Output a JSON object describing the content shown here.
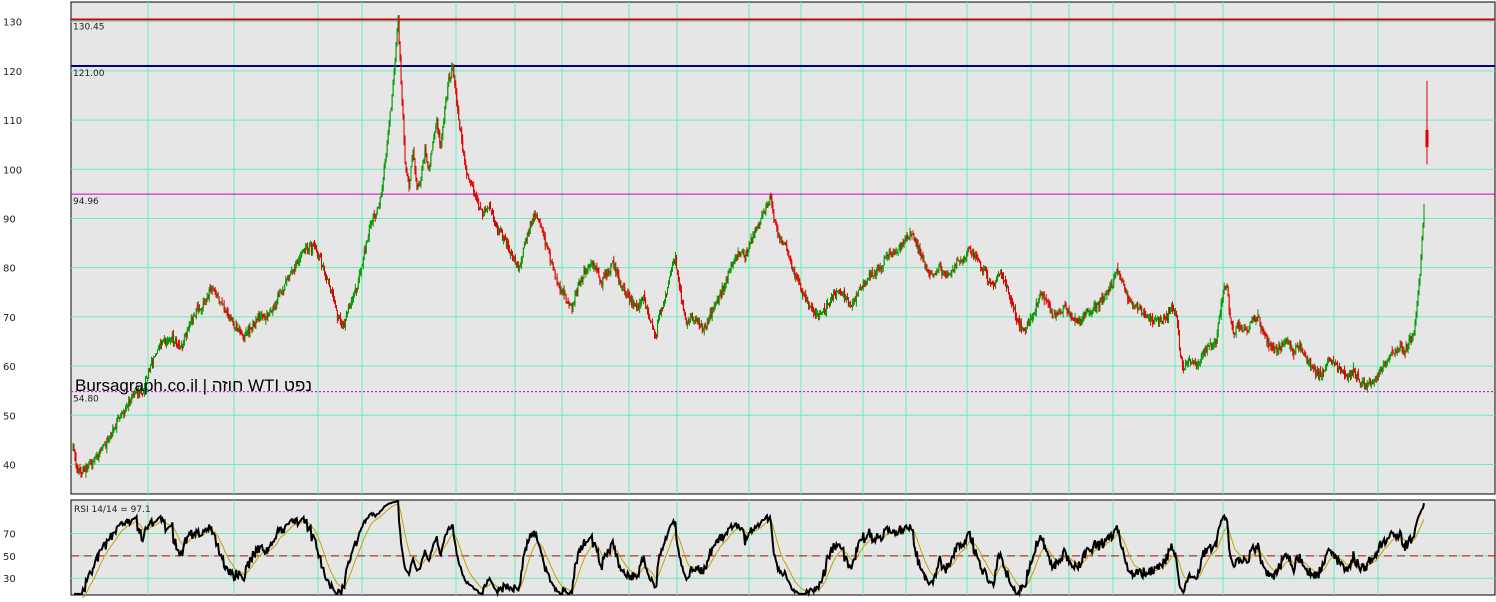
{
  "chart_data": [
    {
      "type": "candlestick",
      "watermark": "Bursagraph.co.il | חוזה WTI נפט",
      "ylim": [
        34,
        134
      ],
      "grid": true,
      "yticks": [
        40,
        50,
        60,
        70,
        80,
        90,
        100,
        110,
        120,
        130
      ],
      "levels": [
        {
          "value": 130.45,
          "label": "130.45",
          "color": "#d00000",
          "style": "solid"
        },
        {
          "value": 121.0,
          "label": "121.00",
          "color": "#000080",
          "style": "solid"
        },
        {
          "value": 94.96,
          "label": "94.96",
          "color": "#d000d0",
          "style": "solid"
        },
        {
          "value": 54.8,
          "label": "54.80",
          "color": "#d000d0",
          "style": "dotted"
        }
      ],
      "price_path": [
        [
          0,
          43.5
        ],
        [
          4,
          39
        ],
        [
          9,
          38.5
        ],
        [
          16,
          40
        ],
        [
          22,
          41
        ],
        [
          30,
          43
        ],
        [
          38,
          46
        ],
        [
          46,
          49
        ],
        [
          54,
          52
        ],
        [
          62,
          54.5
        ],
        [
          70,
          55
        ],
        [
          76,
          59
        ],
        [
          84,
          63
        ],
        [
          92,
          65
        ],
        [
          100,
          66
        ],
        [
          108,
          63
        ],
        [
          116,
          68
        ],
        [
          124,
          71
        ],
        [
          132,
          73
        ],
        [
          140,
          76
        ],
        [
          148,
          73
        ],
        [
          156,
          70
        ],
        [
          164,
          68
        ],
        [
          172,
          66
        ],
        [
          180,
          68
        ],
        [
          188,
          70
        ],
        [
          196,
          70
        ],
        [
          204,
          73
        ],
        [
          212,
          76
        ],
        [
          220,
          79
        ],
        [
          228,
          82
        ],
        [
          236,
          84
        ],
        [
          244,
          84
        ],
        [
          252,
          80
        ],
        [
          260,
          75
        ],
        [
          266,
          70
        ],
        [
          272,
          68
        ],
        [
          278,
          72
        ],
        [
          284,
          75
        ],
        [
          290,
          80
        ],
        [
          296,
          86
        ],
        [
          302,
          90
        ],
        [
          308,
          93
        ],
        [
          312,
          98
        ],
        [
          316,
          105
        ],
        [
          320,
          113
        ],
        [
          324,
          122
        ],
        [
          327,
          130.45
        ],
        [
          330,
          118
        ],
        [
          334,
          102
        ],
        [
          338,
          96
        ],
        [
          342,
          104
        ],
        [
          346,
          96
        ],
        [
          350,
          98
        ],
        [
          354,
          104
        ],
        [
          358,
          100
        ],
        [
          362,
          106
        ],
        [
          366,
          110
        ],
        [
          370,
          104
        ],
        [
          374,
          112
        ],
        [
          378,
          118
        ],
        [
          382,
          121
        ],
        [
          386,
          113
        ],
        [
          390,
          108
        ],
        [
          394,
          101
        ],
        [
          400,
          97
        ],
        [
          406,
          94
        ],
        [
          412,
          91
        ],
        [
          418,
          93
        ],
        [
          424,
          89
        ],
        [
          430,
          87
        ],
        [
          436,
          85
        ],
        [
          442,
          82
        ],
        [
          448,
          80
        ],
        [
          454,
          84
        ],
        [
          460,
          89
        ],
        [
          466,
          91
        ],
        [
          472,
          87
        ],
        [
          478,
          83
        ],
        [
          484,
          79
        ],
        [
          490,
          76
        ],
        [
          496,
          74
        ],
        [
          502,
          72
        ],
        [
          508,
          76
        ],
        [
          514,
          79
        ],
        [
          520,
          81
        ],
        [
          526,
          80
        ],
        [
          532,
          77
        ],
        [
          538,
          79
        ],
        [
          544,
          81
        ],
        [
          550,
          77
        ],
        [
          556,
          75
        ],
        [
          562,
          73
        ],
        [
          568,
          72
        ],
        [
          574,
          74
        ],
        [
          580,
          70
        ],
        [
          586,
          66
        ],
        [
          590,
          70
        ],
        [
          594,
          73
        ],
        [
          598,
          75
        ],
        [
          602,
          80
        ],
        [
          606,
          82
        ],
        [
          610,
          76
        ],
        [
          614,
          72
        ],
        [
          618,
          68
        ],
        [
          622,
          70
        ],
        [
          626,
          70
        ],
        [
          630,
          69
        ],
        [
          634,
          67
        ],
        [
          640,
          70
        ],
        [
          646,
          72
        ],
        [
          652,
          75
        ],
        [
          658,
          78
        ],
        [
          664,
          81
        ],
        [
          670,
          83
        ],
        [
          676,
          82
        ],
        [
          682,
          86
        ],
        [
          688,
          88
        ],
        [
          694,
          91
        ],
        [
          698,
          93
        ],
        [
          702,
          94
        ],
        [
          706,
          89
        ],
        [
          710,
          86
        ],
        [
          716,
          85
        ],
        [
          722,
          81
        ],
        [
          728,
          78
        ],
        [
          734,
          75
        ],
        [
          740,
          72
        ],
        [
          746,
          71
        ],
        [
          752,
          70
        ],
        [
          758,
          72
        ],
        [
          764,
          74
        ],
        [
          770,
          76
        ],
        [
          776,
          74
        ],
        [
          782,
          72
        ],
        [
          788,
          74
        ],
        [
          794,
          76
        ],
        [
          800,
          78
        ],
        [
          806,
          79
        ],
        [
          812,
          80
        ],
        [
          818,
          82
        ],
        [
          824,
          83
        ],
        [
          830,
          84
        ],
        [
          836,
          86
        ],
        [
          842,
          87
        ],
        [
          848,
          85
        ],
        [
          854,
          82
        ],
        [
          860,
          79
        ],
        [
          866,
          78
        ],
        [
          872,
          80
        ],
        [
          878,
          78
        ],
        [
          884,
          79
        ],
        [
          890,
          81
        ],
        [
          896,
          82
        ],
        [
          902,
          84
        ],
        [
          908,
          82
        ],
        [
          914,
          80
        ],
        [
          920,
          78
        ],
        [
          926,
          76
        ],
        [
          932,
          79
        ],
        [
          938,
          77
        ],
        [
          944,
          73
        ],
        [
          950,
          69
        ],
        [
          956,
          67
        ],
        [
          962,
          69
        ],
        [
          968,
          72
        ],
        [
          974,
          75
        ],
        [
          980,
          73
        ],
        [
          986,
          70
        ],
        [
          992,
          71
        ],
        [
          998,
          72
        ],
        [
          1004,
          70
        ],
        [
          1010,
          69
        ],
        [
          1016,
          70
        ],
        [
          1022,
          71
        ],
        [
          1028,
          72
        ],
        [
          1034,
          73
        ],
        [
          1040,
          75
        ],
        [
          1046,
          77
        ],
        [
          1050,
          80
        ],
        [
          1054,
          78
        ],
        [
          1058,
          75
        ],
        [
          1064,
          73
        ],
        [
          1070,
          72
        ],
        [
          1076,
          71
        ],
        [
          1082,
          70
        ],
        [
          1088,
          69
        ],
        [
          1094,
          69
        ],
        [
          1100,
          70
        ],
        [
          1106,
          72
        ],
        [
          1110,
          70
        ],
        [
          1114,
          62
        ],
        [
          1118,
          59
        ],
        [
          1122,
          62
        ],
        [
          1126,
          60
        ],
        [
          1132,
          61
        ],
        [
          1138,
          63
        ],
        [
          1144,
          64
        ],
        [
          1150,
          65
        ],
        [
          1156,
          74
        ],
        [
          1160,
          77
        ],
        [
          1164,
          70
        ],
        [
          1168,
          67
        ],
        [
          1174,
          68
        ],
        [
          1180,
          67
        ],
        [
          1186,
          69
        ],
        [
          1192,
          70
        ],
        [
          1198,
          66
        ],
        [
          1204,
          64
        ],
        [
          1210,
          63
        ],
        [
          1216,
          64
        ],
        [
          1222,
          65
        ],
        [
          1228,
          63
        ],
        [
          1234,
          64
        ],
        [
          1240,
          62
        ],
        [
          1246,
          60
        ],
        [
          1252,
          58
        ],
        [
          1258,
          59
        ],
        [
          1264,
          61
        ],
        [
          1270,
          60
        ],
        [
          1276,
          59
        ],
        [
          1282,
          58
        ],
        [
          1288,
          59
        ],
        [
          1294,
          57
        ],
        [
          1300,
          56
        ],
        [
          1306,
          57
        ],
        [
          1312,
          58
        ],
        [
          1318,
          60
        ],
        [
          1324,
          62
        ],
        [
          1330,
          63
        ],
        [
          1336,
          64
        ],
        [
          1340,
          63
        ],
        [
          1344,
          65
        ],
        [
          1348,
          66
        ],
        [
          1351,
          70
        ],
        [
          1353,
          75
        ],
        [
          1355,
          79
        ],
        [
          1357,
          86
        ],
        [
          1359,
          92
        ]
      ],
      "last_candle": {
        "open": 108,
        "high": 118,
        "low": 101,
        "close": 104.5
      }
    },
    {
      "type": "line",
      "title": "RSI 14/14 = 97.1",
      "ylim": [
        15,
        100
      ],
      "yticks": [
        30,
        50,
        70
      ],
      "reference_line": {
        "value": 50,
        "color": "#d00000",
        "style": "dashed"
      },
      "last_value": 97.1
    }
  ]
}
